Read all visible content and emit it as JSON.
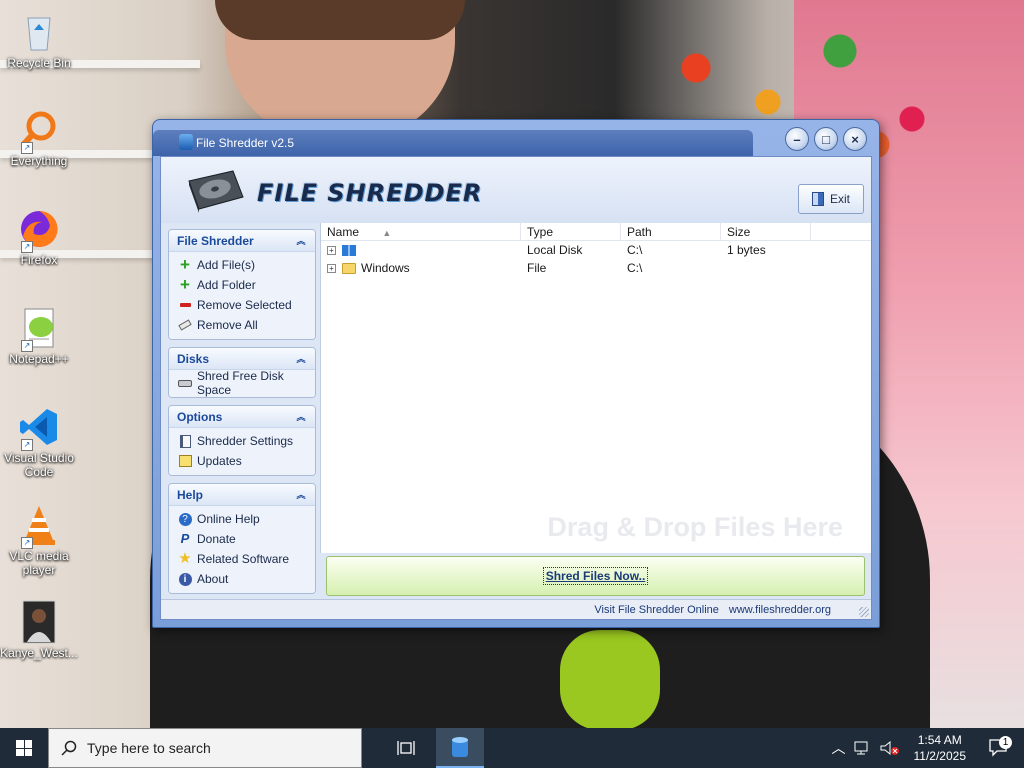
{
  "desktop": {
    "icons": [
      {
        "label": "Recycle Bin",
        "icon": "recycle-bin-icon"
      },
      {
        "label": "Everything",
        "icon": "everything-search-icon"
      },
      {
        "label": "Firefox",
        "icon": "firefox-icon"
      },
      {
        "label": "Notepad++",
        "icon": "notepad-plus-plus-icon"
      },
      {
        "label": "Visual Studio Code",
        "icon": "vscode-icon"
      },
      {
        "label": "VLC media player",
        "icon": "vlc-icon"
      },
      {
        "label": "Kanye_West...",
        "icon": "image-file-icon"
      }
    ]
  },
  "window": {
    "title": "File Shredder v2.5",
    "logo_text": "FILE SHREDDER",
    "exit_label": "Exit",
    "controls": {
      "minimize": "–",
      "maximize": "□",
      "close": "×"
    }
  },
  "sidebar": {
    "panels": [
      {
        "title": "File Shredder",
        "items": [
          {
            "label": "Add File(s)",
            "icon": "add-icon"
          },
          {
            "label": "Add Folder",
            "icon": "add-icon"
          },
          {
            "label": "Remove Selected",
            "icon": "remove-icon"
          },
          {
            "label": "Remove All",
            "icon": "eraser-icon"
          }
        ]
      },
      {
        "title": "Disks",
        "items": [
          {
            "label": "Shred Free Disk Space",
            "icon": "disk-icon"
          }
        ]
      },
      {
        "title": "Options",
        "items": [
          {
            "label": "Shredder Settings",
            "icon": "settings-icon"
          },
          {
            "label": "Updates",
            "icon": "updates-icon"
          }
        ]
      },
      {
        "title": "Help",
        "items": [
          {
            "label": "Online Help",
            "icon": "help-icon"
          },
          {
            "label": "Donate",
            "icon": "paypal-icon"
          },
          {
            "label": "Related Software",
            "icon": "star-icon"
          },
          {
            "label": "About",
            "icon": "info-icon"
          }
        ]
      }
    ]
  },
  "file_list": {
    "columns": [
      "Name",
      "Type",
      "Path",
      "Size"
    ],
    "rows": [
      {
        "name": "",
        "type": "Local Disk",
        "path": "C:\\",
        "size": "1 bytes",
        "icon": "drive-icon"
      },
      {
        "name": "Windows",
        "type": "File",
        "path": "C:\\",
        "size": "",
        "icon": "folder-icon"
      }
    ],
    "drop_hint": "Drag & Drop Files Here"
  },
  "shred_button": "Shred Files Now..",
  "status": {
    "link_label": "Visit File Shredder Online",
    "url": "www.fileshredder.org"
  },
  "taskbar": {
    "search_placeholder": "Type here to search",
    "time": "1:54 AM",
    "date": "11/2/2025",
    "notification_count": "1"
  }
}
